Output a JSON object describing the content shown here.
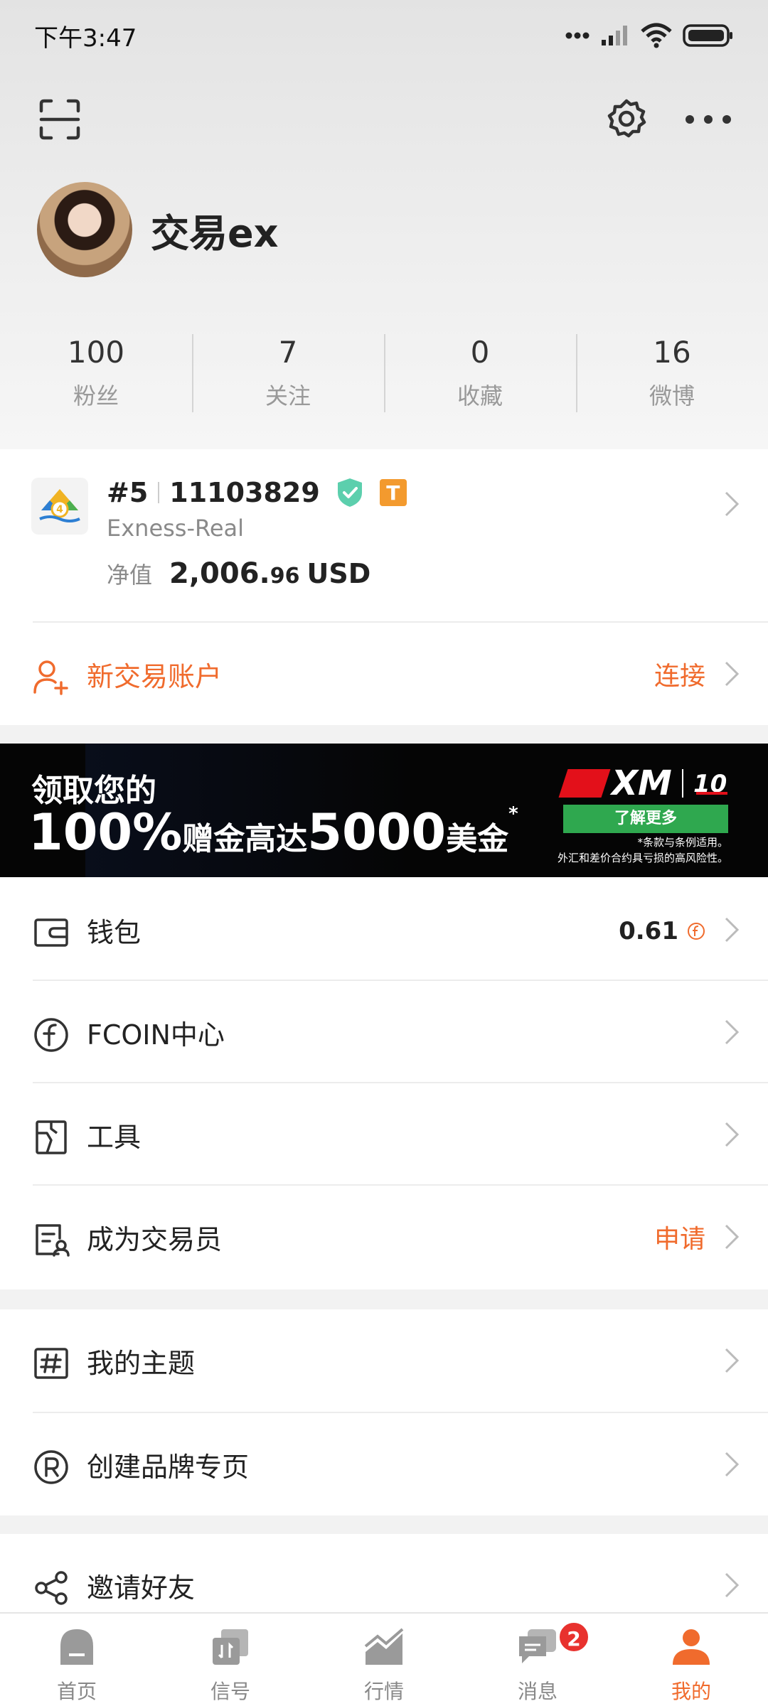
{
  "status": {
    "time": "下午3:47"
  },
  "profile": {
    "name": "交易ex",
    "stats": [
      {
        "value": "100",
        "label": "粉丝"
      },
      {
        "value": "7",
        "label": "关注"
      },
      {
        "value": "0",
        "label": "收藏"
      },
      {
        "value": "16",
        "label": "微博"
      }
    ]
  },
  "account": {
    "rank": "#5",
    "number": "11103829",
    "badge": "T",
    "server": "Exness-Real",
    "equity_label": "净值",
    "equity_main": "2,006.",
    "equity_decimals": "96",
    "currency": "USD",
    "new_account_label": "新交易账户",
    "connect_label": "连接"
  },
  "ad": {
    "line1": "领取您的",
    "percent": "100%",
    "text_mid": "赠金高达",
    "amount": "5000",
    "text_end": "美金",
    "asterisk": "*",
    "brand": "XM",
    "button": "了解更多",
    "fine1": "*条款与条例适用。",
    "fine2": "外汇和差价合约具亏损的高风险性。"
  },
  "menu": {
    "wallet": {
      "label": "钱包",
      "value": "0.61"
    },
    "fcoin": {
      "label": "FCOIN中心"
    },
    "tools": {
      "label": "工具"
    },
    "trader": {
      "label": "成为交易员",
      "value": "申请"
    },
    "topics": {
      "label": "我的主题"
    },
    "brand": {
      "label": "创建品牌专页"
    },
    "invite": {
      "label": "邀请好友"
    }
  },
  "tabbar": {
    "tabs": [
      {
        "label": "首页"
      },
      {
        "label": "信号"
      },
      {
        "label": "行情"
      },
      {
        "label": "消息",
        "badge": "2"
      },
      {
        "label": "我的"
      }
    ]
  },
  "colors": {
    "accent": "#f06b2d",
    "verified": "#5ccfad",
    "badge": "#f39a2e",
    "ad_button": "#2fa84f"
  }
}
